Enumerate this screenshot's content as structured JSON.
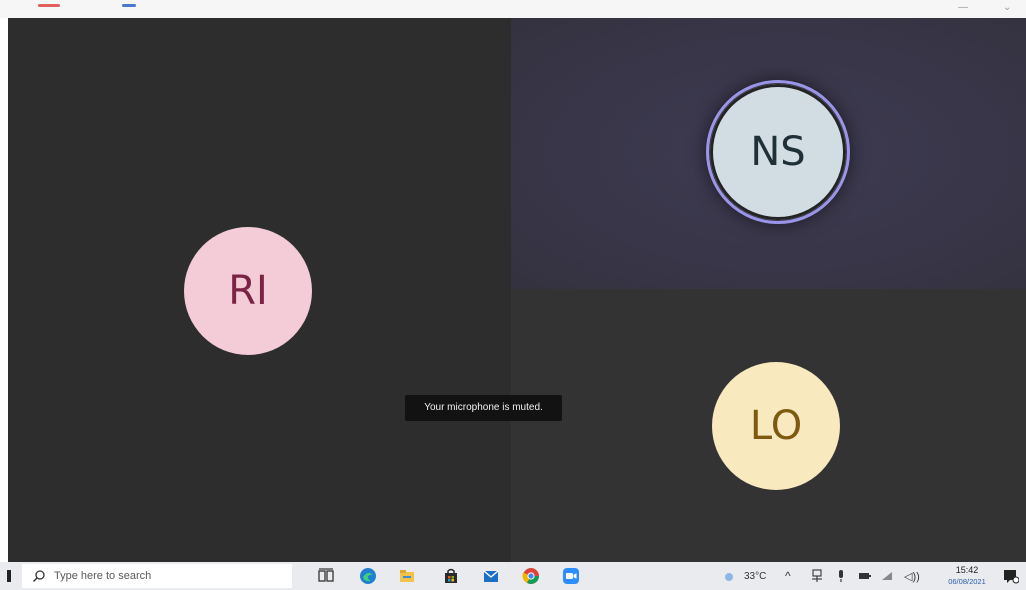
{
  "participants": [
    {
      "initials": "RI"
    },
    {
      "initials": "NS"
    },
    {
      "initials": "LO"
    }
  ],
  "notification": {
    "text": "Your microphone is muted."
  },
  "taskbar": {
    "search_placeholder": "Type here to search",
    "pinned_icons": [
      "task-view-icon",
      "edge-icon",
      "file-explorer-icon",
      "store-icon",
      "mail-icon",
      "chrome-icon",
      "zoom-icon"
    ],
    "tray": {
      "temperature": "33°C",
      "time": "15:42",
      "date": "06/08/2021"
    }
  },
  "colors": {
    "speaker_ring": "#9b95e8",
    "ri_avatar": "#f3ccd8",
    "ns_avatar": "#d1dde3",
    "lo_avatar": "#f9e9be"
  }
}
